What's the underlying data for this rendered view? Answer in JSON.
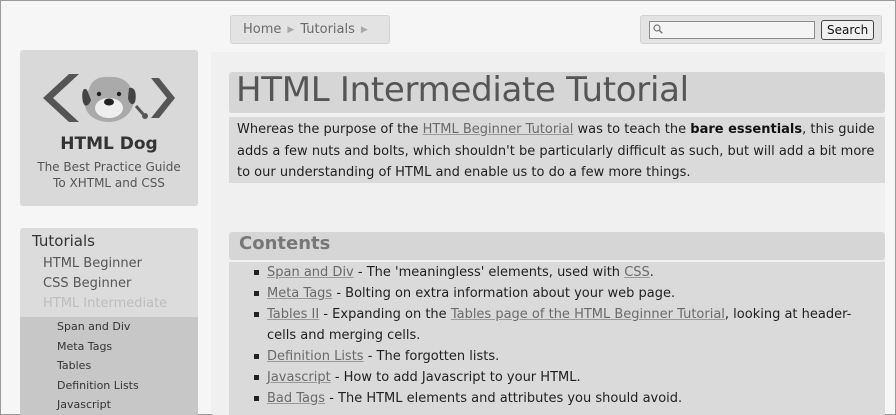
{
  "breadcrumb": {
    "home": "Home",
    "tutorials": "Tutorials"
  },
  "search": {
    "placeholder": "",
    "button": "Search"
  },
  "logo": {
    "name": "HTML Dog",
    "tagline_line1": "The Best Practice Guide",
    "tagline_line2": "To XHTML and CSS"
  },
  "sidebar": {
    "title": "Tutorials",
    "items": [
      "HTML Beginner",
      "CSS Beginner",
      "HTML Intermediate"
    ],
    "current_index": 2,
    "subitems": [
      "Span and Div",
      "Meta Tags",
      "Tables",
      "Definition Lists",
      "Javascript"
    ]
  },
  "main": {
    "title": "HTML Intermediate Tutorial",
    "intro": {
      "part1": "Whereas the purpose of the ",
      "link": "HTML Beginner Tutorial",
      "part2": " was to teach the ",
      "bold": "bare essentials",
      "part3": ", this guide adds a few nuts and bolts, which shouldn't be particularly difficult as such, but will add a bit more to our understanding of HTML and enable us to do a few more things."
    },
    "contents_title": "Contents",
    "contents": [
      {
        "link": "Span and Div",
        "text": " - The 'meaningless' elements, used with ",
        "link2": "CSS",
        "text2": "."
      },
      {
        "link": "Meta Tags",
        "text": " - Bolting on extra information about your web page."
      },
      {
        "link": "Tables II",
        "text": " - Expanding on the ",
        "link2": "Tables page of the HTML Beginner Tutorial",
        "text2": ", looking at header-cells and merging cells."
      },
      {
        "link": "Definition Lists",
        "text": " - The forgotten lists."
      },
      {
        "link": "Javascript",
        "text": " - How to add Javascript to your HTML."
      },
      {
        "link": "Bad Tags",
        "text": " - The HTML elements and attributes you should avoid."
      }
    ]
  }
}
